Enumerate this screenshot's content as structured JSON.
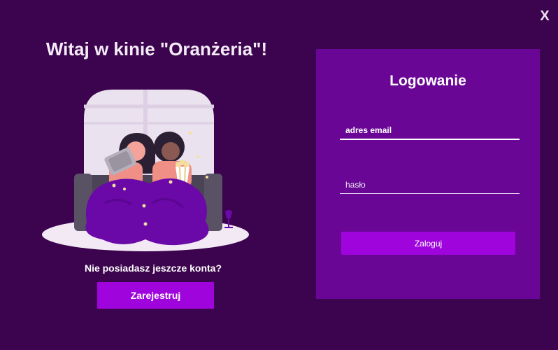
{
  "window": {
    "close_label": "X"
  },
  "welcome": {
    "title": "Witaj w kinie \"Oranżeria\"!",
    "no_account_text": "Nie posiadasz jeszcze konta?",
    "register_label": "Zarejestruj"
  },
  "login": {
    "title": "Logowanie",
    "email_placeholder": "adres email",
    "password_placeholder": "hasło",
    "submit_label": "Zaloguj"
  },
  "colors": {
    "background": "#3c044e",
    "panel": "#6a0696",
    "accent": "#a004dc"
  }
}
